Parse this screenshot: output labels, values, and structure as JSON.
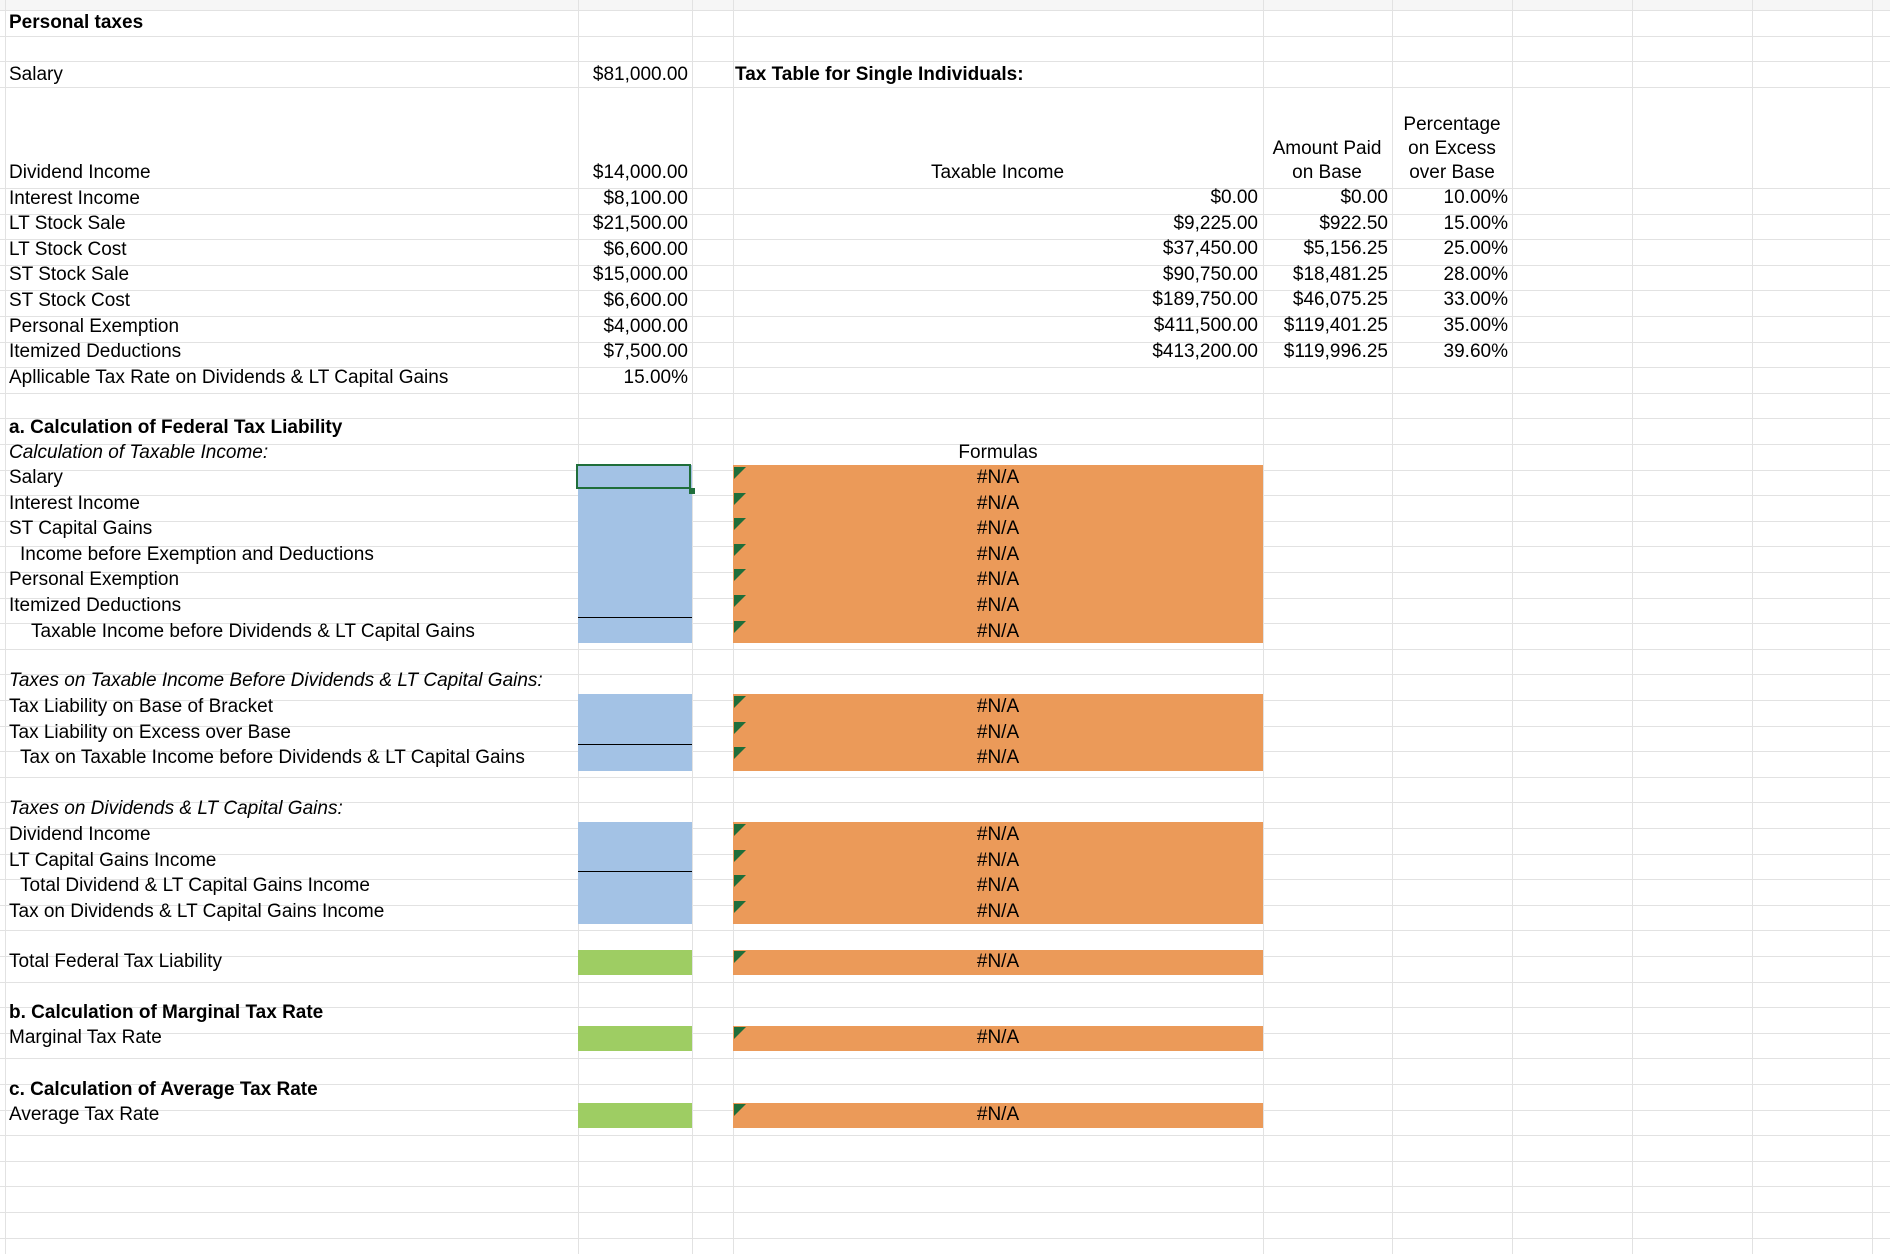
{
  "sheet": {
    "title": "Personal taxes",
    "tax_table_title": "Tax Table for Single Individuals:",
    "inputs": [
      {
        "label": "Salary",
        "value": "$81,000.00"
      },
      {
        "label": "Dividend Income",
        "value": "$14,000.00"
      },
      {
        "label": "Interest Income",
        "value": "$8,100.00"
      },
      {
        "label": "LT Stock Sale",
        "value": "$21,500.00"
      },
      {
        "label": "LT Stock Cost",
        "value": "$6,600.00"
      },
      {
        "label": "ST Stock Sale",
        "value": "$15,000.00"
      },
      {
        "label": "ST Stock Cost",
        "value": "$6,600.00"
      },
      {
        "label": "Personal Exemption",
        "value": "$4,000.00"
      },
      {
        "label": "Itemized Deductions",
        "value": "$7,500.00"
      },
      {
        "label": "Apllicable Tax Rate on Dividends & LT Capital Gains",
        "value": "15.00%"
      }
    ],
    "tax_table": {
      "header_taxable": "Taxable Income",
      "header_base_line1": "Amount Paid",
      "header_base_line2": "on Base",
      "header_pct_line1": "Percentage",
      "header_pct_line2": "on Excess",
      "header_pct_line3": "over Base",
      "rows": [
        {
          "income": "$0.00",
          "base": "$0.00",
          "pct": "10.00%"
        },
        {
          "income": "$9,225.00",
          "base": "$922.50",
          "pct": "15.00%"
        },
        {
          "income": "$37,450.00",
          "base": "$5,156.25",
          "pct": "25.00%"
        },
        {
          "income": "$90,750.00",
          "base": "$18,481.25",
          "pct": "28.00%"
        },
        {
          "income": "$189,750.00",
          "base": "$46,075.25",
          "pct": "33.00%"
        },
        {
          "income": "$411,500.00",
          "base": "$119,401.25",
          "pct": "35.00%"
        },
        {
          "income": "$413,200.00",
          "base": "$119,996.25",
          "pct": "39.60%"
        }
      ]
    },
    "section_a": {
      "title": "a.  Calculation of Federal Tax Liability",
      "subtitle": "Calculation of Taxable Income:",
      "formulas_header": "Formulas",
      "na": "#N/A",
      "rows1": [
        "Salary",
        "Interest Income",
        "ST Capital Gains",
        "Income before Exemption and Deductions",
        "Personal Exemption",
        "Itemized Deductions",
        "Taxable Income before Dividends & LT Capital Gains"
      ],
      "subtitle2": "Taxes on Taxable Income Before Dividends & LT Capital Gains:",
      "rows2": [
        "Tax Liability on Base of Bracket",
        "Tax Liability on Excess over Base",
        "Tax on Taxable Income before Dividends & LT Capital Gains"
      ],
      "subtitle3": "Taxes on Dividends & LT Capital Gains:",
      "rows3": [
        "Dividend Income",
        "LT Capital Gains Income",
        "Total Dividend & LT Capital Gains Income",
        "Tax on Dividends & LT Capital Gains Income"
      ],
      "total_label": "Total Federal Tax Liability"
    },
    "section_b": {
      "title": "b. Calculation of Marginal Tax Rate",
      "label": "Marginal Tax Rate"
    },
    "section_c": {
      "title": "c. Calculation of Average Tax Rate",
      "label": "Average Tax Rate"
    }
  }
}
